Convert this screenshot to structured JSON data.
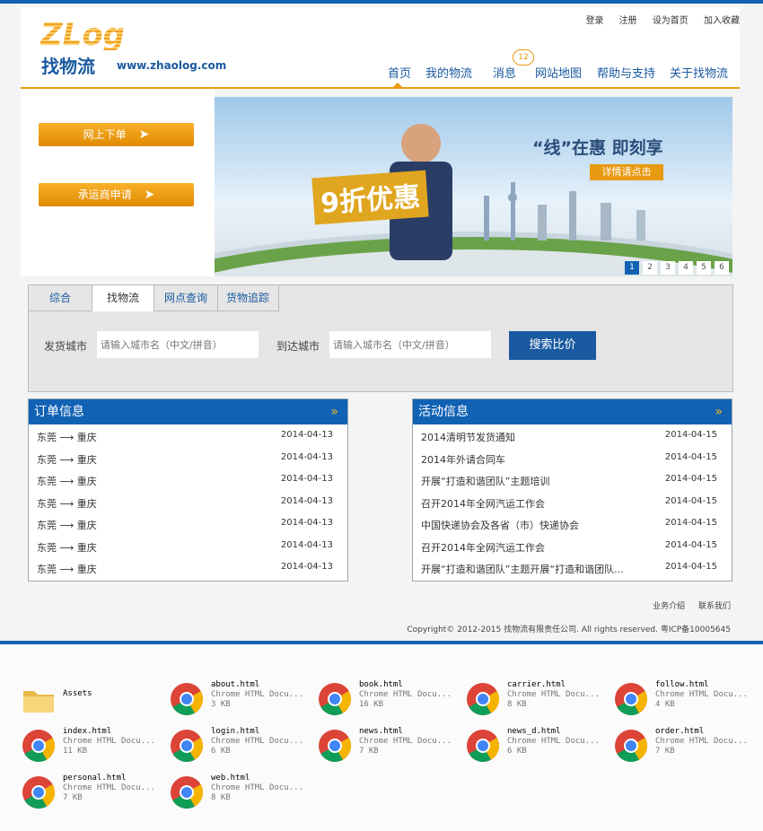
{
  "header": {
    "logo_text": "ZLog",
    "brand_cn": "找物流",
    "brand_url": "www.zhaolog.com",
    "top_links": [
      "登录",
      "注册",
      "设为首页",
      "加入收藏"
    ],
    "nav": [
      "首页",
      "我的物流",
      "消息",
      "网站地图",
      "帮助与支持",
      "关于找物流"
    ],
    "message_badge": "12"
  },
  "left_buttons": {
    "order_label": "网上下单",
    "carrier_label": "承运商申请"
  },
  "banner": {
    "slogan": "“线”在惠  即刻享",
    "cta": "详情请点击",
    "discount": "9折优惠",
    "pages": [
      "1",
      "2",
      "3",
      "4",
      "5",
      "6"
    ],
    "active_page": "1"
  },
  "search": {
    "tabs": [
      "综合",
      "找物流",
      "网点查询",
      "货物追踪"
    ],
    "active_tab": "找物流",
    "from_label": "发货城市",
    "to_label": "到达城市",
    "from_placeholder": "请输入城市名（中文/拼音）",
    "to_placeholder": "请输入城市名（中文/拼音）",
    "button": "搜索比价"
  },
  "orders": {
    "title": "订单信息",
    "more": "»",
    "items": [
      {
        "route": "东莞 ⟶ 重庆",
        "date": "2014-04-13"
      },
      {
        "route": "东莞 ⟶ 重庆",
        "date": "2014-04-13"
      },
      {
        "route": "东莞 ⟶ 重庆",
        "date": "2014-04-13"
      },
      {
        "route": "东莞 ⟶ 重庆",
        "date": "2014-04-13"
      },
      {
        "route": "东莞 ⟶ 重庆",
        "date": "2014-04-13"
      },
      {
        "route": "东莞 ⟶ 重庆",
        "date": "2014-04-13"
      },
      {
        "route": "东莞 ⟶ 重庆",
        "date": "2014-04-13"
      }
    ]
  },
  "activities": {
    "title": "活动信息",
    "more": "»",
    "items": [
      {
        "text": "2014清明节发货通知",
        "date": "2014-04-15"
      },
      {
        "text": "2014年外请合同车",
        "date": "2014-04-15"
      },
      {
        "text": "开展“打造和谐团队”主题培训",
        "date": "2014-04-15"
      },
      {
        "text": "召开2014年全网汽运工作会",
        "date": "2014-04-15"
      },
      {
        "text": "中国快递协会及各省（市）快递协会",
        "date": "2014-04-15"
      },
      {
        "text": "召开2014年全网汽运工作会",
        "date": "2014-04-15"
      },
      {
        "text": "开展“打造和谐团队”主题开展“打造和谐团队...",
        "date": "2014-04-15"
      }
    ]
  },
  "footer": {
    "links": [
      "业务介绍",
      "联系我们"
    ],
    "copyright": "Copyright© 2012-2015  找物流有限责任公司.  All  rights  reserved.  粤ICP备10005645"
  },
  "explorer": {
    "folder": "Assets",
    "files": [
      {
        "name": "about.html",
        "type": "Chrome HTML Docu...",
        "size": "3 KB"
      },
      {
        "name": "book.html",
        "type": "Chrome HTML Docu...",
        "size": "16 KB"
      },
      {
        "name": "carrier.html",
        "type": "Chrome HTML Docu...",
        "size": "8 KB"
      },
      {
        "name": "follow.html",
        "type": "Chrome HTML Docu...",
        "size": "4 KB"
      },
      {
        "name": "index.html",
        "type": "Chrome HTML Docu...",
        "size": "11 KB"
      },
      {
        "name": "login.html",
        "type": "Chrome HTML Docu...",
        "size": "6 KB"
      },
      {
        "name": "news.html",
        "type": "Chrome HTML Docu...",
        "size": "7 KB"
      },
      {
        "name": "news_d.html",
        "type": "Chrome HTML Docu...",
        "size": "6 KB"
      },
      {
        "name": "order.html",
        "type": "Chrome HTML Docu...",
        "size": "7 KB"
      },
      {
        "name": "personal.html",
        "type": "Chrome HTML Docu...",
        "size": "7 KB"
      },
      {
        "name": "web.html",
        "type": "Chrome HTML Docu...",
        "size": "8 KB"
      }
    ]
  },
  "colors": {
    "brand_blue": "#1262b4",
    "accent_orange": "#e89a10"
  }
}
